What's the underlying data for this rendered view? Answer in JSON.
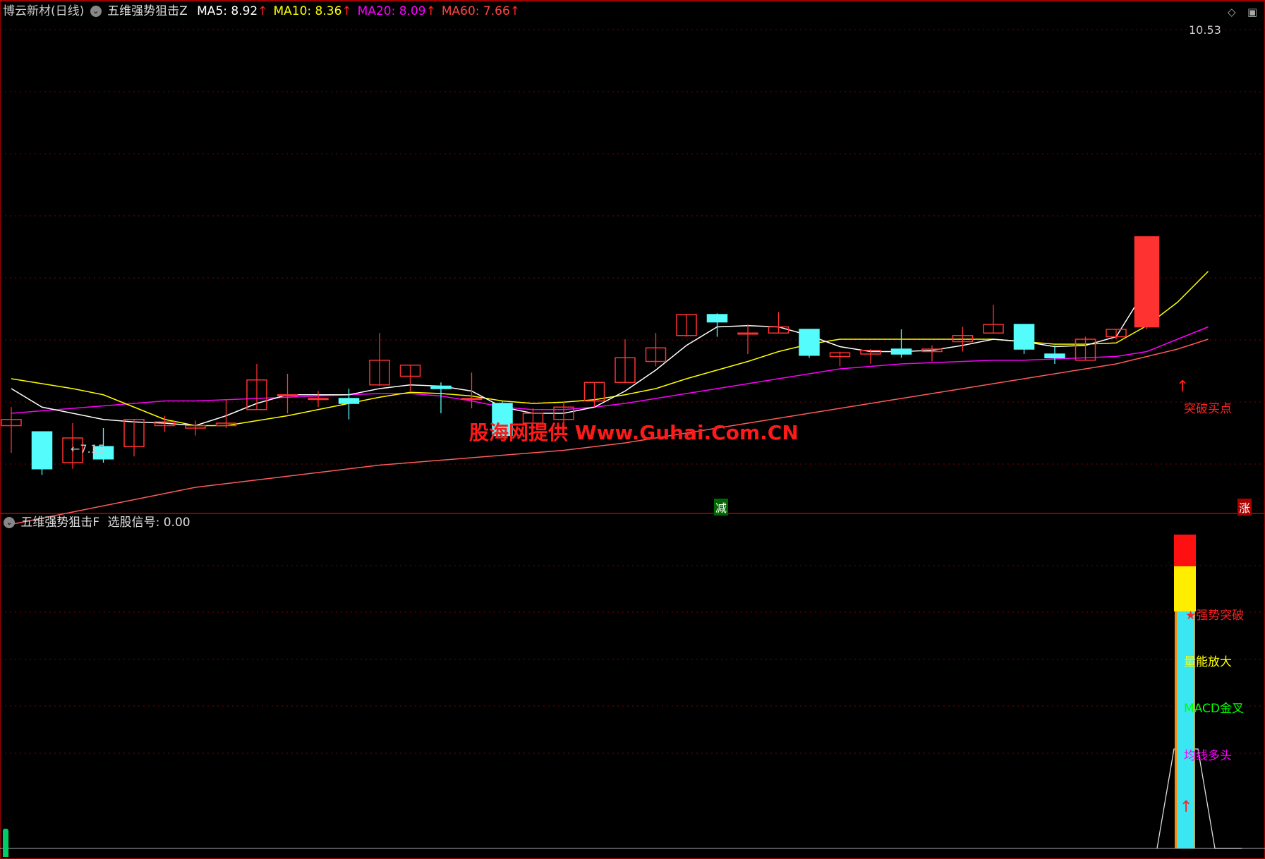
{
  "main": {
    "stock_name": "博云新材(日线)",
    "indicator_name": "五维强势狙击Z",
    "ma": [
      {
        "label": "MA5: 8.92",
        "arrow": "↑",
        "color": "#ffffff"
      },
      {
        "label": "MA10: 8.36",
        "arrow": "↑",
        "color": "#ffff00"
      },
      {
        "label": "MA20: 8.09",
        "arrow": "↑",
        "color": "#ff00ff"
      },
      {
        "label": "MA60: 7.66",
        "arrow": "↑",
        "color": "#ff4444"
      }
    ],
    "high_label": "10.53",
    "low_label": "←7.15",
    "watermark": "股海网提供 Www.Guhai.Com.CN",
    "breakout_label": "突破买点",
    "reduce_badge": "减",
    "rise_badge": "涨"
  },
  "sub": {
    "indicator_name": "五维强势狙击F",
    "signal_label": "选股信号: 0.00",
    "labels": [
      {
        "text": "★强势突破",
        "color": "#ff2222"
      },
      {
        "text": "量能放大",
        "color": "#ffff00"
      },
      {
        "text": "MACD金叉",
        "color": "#00ff00"
      },
      {
        "text": "均线多头",
        "color": "#ff00ff"
      }
    ]
  },
  "colors": {
    "up": "#ff3232",
    "down": "#54fcfc",
    "grid": "#800000",
    "border": "#a00000"
  },
  "candles": [
    {
      "o": 7.8,
      "c": 7.85,
      "h": 7.95,
      "l": 7.58
    },
    {
      "o": 7.75,
      "c": 7.45,
      "h": 7.75,
      "l": 7.4
    },
    {
      "o": 7.5,
      "c": 7.7,
      "h": 7.82,
      "l": 7.45
    },
    {
      "o": 7.63,
      "c": 7.53,
      "h": 7.78,
      "l": 7.5
    },
    {
      "o": 7.63,
      "c": 7.85,
      "h": 7.85,
      "l": 7.55
    },
    {
      "o": 7.8,
      "c": 7.83,
      "h": 7.88,
      "l": 7.75
    },
    {
      "o": 7.78,
      "c": 7.8,
      "h": 7.84,
      "l": 7.72
    },
    {
      "o": 7.8,
      "c": 7.82,
      "h": 8.01,
      "l": 7.78
    },
    {
      "o": 7.93,
      "c": 8.17,
      "h": 8.3,
      "l": 7.93
    },
    {
      "o": 8.05,
      "c": 8.05,
      "h": 8.22,
      "l": 7.9
    },
    {
      "o": 8.02,
      "c": 8.02,
      "h": 8.08,
      "l": 7.95
    },
    {
      "o": 8.02,
      "c": 7.98,
      "h": 8.1,
      "l": 7.85
    },
    {
      "o": 8.13,
      "c": 8.33,
      "h": 8.55,
      "l": 8.12
    },
    {
      "o": 8.2,
      "c": 8.29,
      "h": 8.29,
      "l": 8.08
    },
    {
      "o": 8.12,
      "c": 8.1,
      "h": 8.15,
      "l": 7.9
    },
    {
      "o": 8.02,
      "c": 8.02,
      "h": 8.23,
      "l": 7.94
    },
    {
      "o": 7.98,
      "c": 7.72,
      "h": 8.0,
      "l": 7.7
    },
    {
      "o": 7.82,
      "c": 7.9,
      "h": 7.94,
      "l": 7.7
    },
    {
      "o": 7.85,
      "c": 7.95,
      "h": 8.0,
      "l": 7.75
    },
    {
      "o": 8.0,
      "c": 8.15,
      "h": 8.15,
      "l": 7.95
    },
    {
      "o": 8.15,
      "c": 8.35,
      "h": 8.5,
      "l": 8.15
    },
    {
      "o": 8.32,
      "c": 8.43,
      "h": 8.55,
      "l": 8.28
    },
    {
      "o": 8.53,
      "c": 8.7,
      "h": 8.7,
      "l": 8.52
    },
    {
      "o": 8.7,
      "c": 8.64,
      "h": 8.71,
      "l": 8.52
    },
    {
      "o": 8.55,
      "c": 8.55,
      "h": 8.62,
      "l": 8.38
    },
    {
      "o": 8.55,
      "c": 8.6,
      "h": 8.72,
      "l": 8.55
    },
    {
      "o": 8.58,
      "c": 8.37,
      "h": 8.58,
      "l": 8.35
    },
    {
      "o": 8.36,
      "c": 8.39,
      "h": 8.4,
      "l": 8.28
    },
    {
      "o": 8.38,
      "c": 8.41,
      "h": 8.42,
      "l": 8.3
    },
    {
      "o": 8.42,
      "c": 8.38,
      "h": 8.58,
      "l": 8.35
    },
    {
      "o": 8.4,
      "c": 8.42,
      "h": 8.45,
      "l": 8.32
    },
    {
      "o": 8.48,
      "c": 8.53,
      "h": 8.6,
      "l": 8.4
    },
    {
      "o": 8.55,
      "c": 8.62,
      "h": 8.78,
      "l": 8.55
    },
    {
      "o": 8.62,
      "c": 8.42,
      "h": 8.62,
      "l": 8.38
    },
    {
      "o": 8.38,
      "c": 8.35,
      "h": 8.45,
      "l": 8.3
    },
    {
      "o": 8.33,
      "c": 8.5,
      "h": 8.52,
      "l": 8.33
    },
    {
      "o": 8.52,
      "c": 8.58,
      "h": 8.58,
      "l": 8.5
    },
    {
      "o": 8.6,
      "c": 9.33,
      "h": 9.33,
      "l": 8.58
    }
  ],
  "ma_lines": {
    "ma5": [
      8.1,
      7.95,
      7.9,
      7.85,
      7.83,
      7.82,
      7.8,
      7.88,
      7.98,
      8.05,
      8.05,
      8.05,
      8.1,
      8.13,
      8.12,
      8.08,
      7.95,
      7.9,
      7.9,
      7.95,
      8.08,
      8.25,
      8.45,
      8.6,
      8.61,
      8.6,
      8.53,
      8.44,
      8.4,
      8.4,
      8.41,
      8.45,
      8.5,
      8.48,
      8.44,
      8.45,
      8.52,
      8.92
    ],
    "ma10": [
      8.18,
      8.14,
      8.1,
      8.05,
      7.95,
      7.85,
      7.8,
      7.8,
      7.84,
      7.88,
      7.93,
      7.98,
      8.03,
      8.07,
      8.06,
      8.04,
      8.0,
      7.98,
      7.99,
      8.01,
      8.05,
      8.1,
      8.18,
      8.25,
      8.32,
      8.4,
      8.46,
      8.5,
      8.5,
      8.5,
      8.5,
      8.5,
      8.5,
      8.48,
      8.46,
      8.46,
      8.47,
      8.61,
      8.8,
      9.05
    ],
    "ma20": [
      7.9,
      7.92,
      7.94,
      7.96,
      7.98,
      8.0,
      8.0,
      8.01,
      8.02,
      8.03,
      8.04,
      8.05,
      8.06,
      8.06,
      8.04,
      8.0,
      7.95,
      7.93,
      7.93,
      7.95,
      7.98,
      8.02,
      8.06,
      8.1,
      8.14,
      8.18,
      8.22,
      8.26,
      8.28,
      8.3,
      8.31,
      8.32,
      8.33,
      8.33,
      8.34,
      8.35,
      8.36,
      8.4,
      8.5,
      8.6
    ],
    "ma60": [
      7.0,
      7.05,
      7.1,
      7.15,
      7.2,
      7.25,
      7.3,
      7.33,
      7.36,
      7.39,
      7.42,
      7.45,
      7.48,
      7.5,
      7.52,
      7.54,
      7.56,
      7.58,
      7.6,
      7.63,
      7.66,
      7.7,
      7.74,
      7.78,
      7.82,
      7.86,
      7.9,
      7.94,
      7.98,
      8.02,
      8.06,
      8.1,
      8.14,
      8.18,
      8.22,
      8.26,
      8.3,
      8.36,
      8.42,
      8.5
    ]
  }
}
